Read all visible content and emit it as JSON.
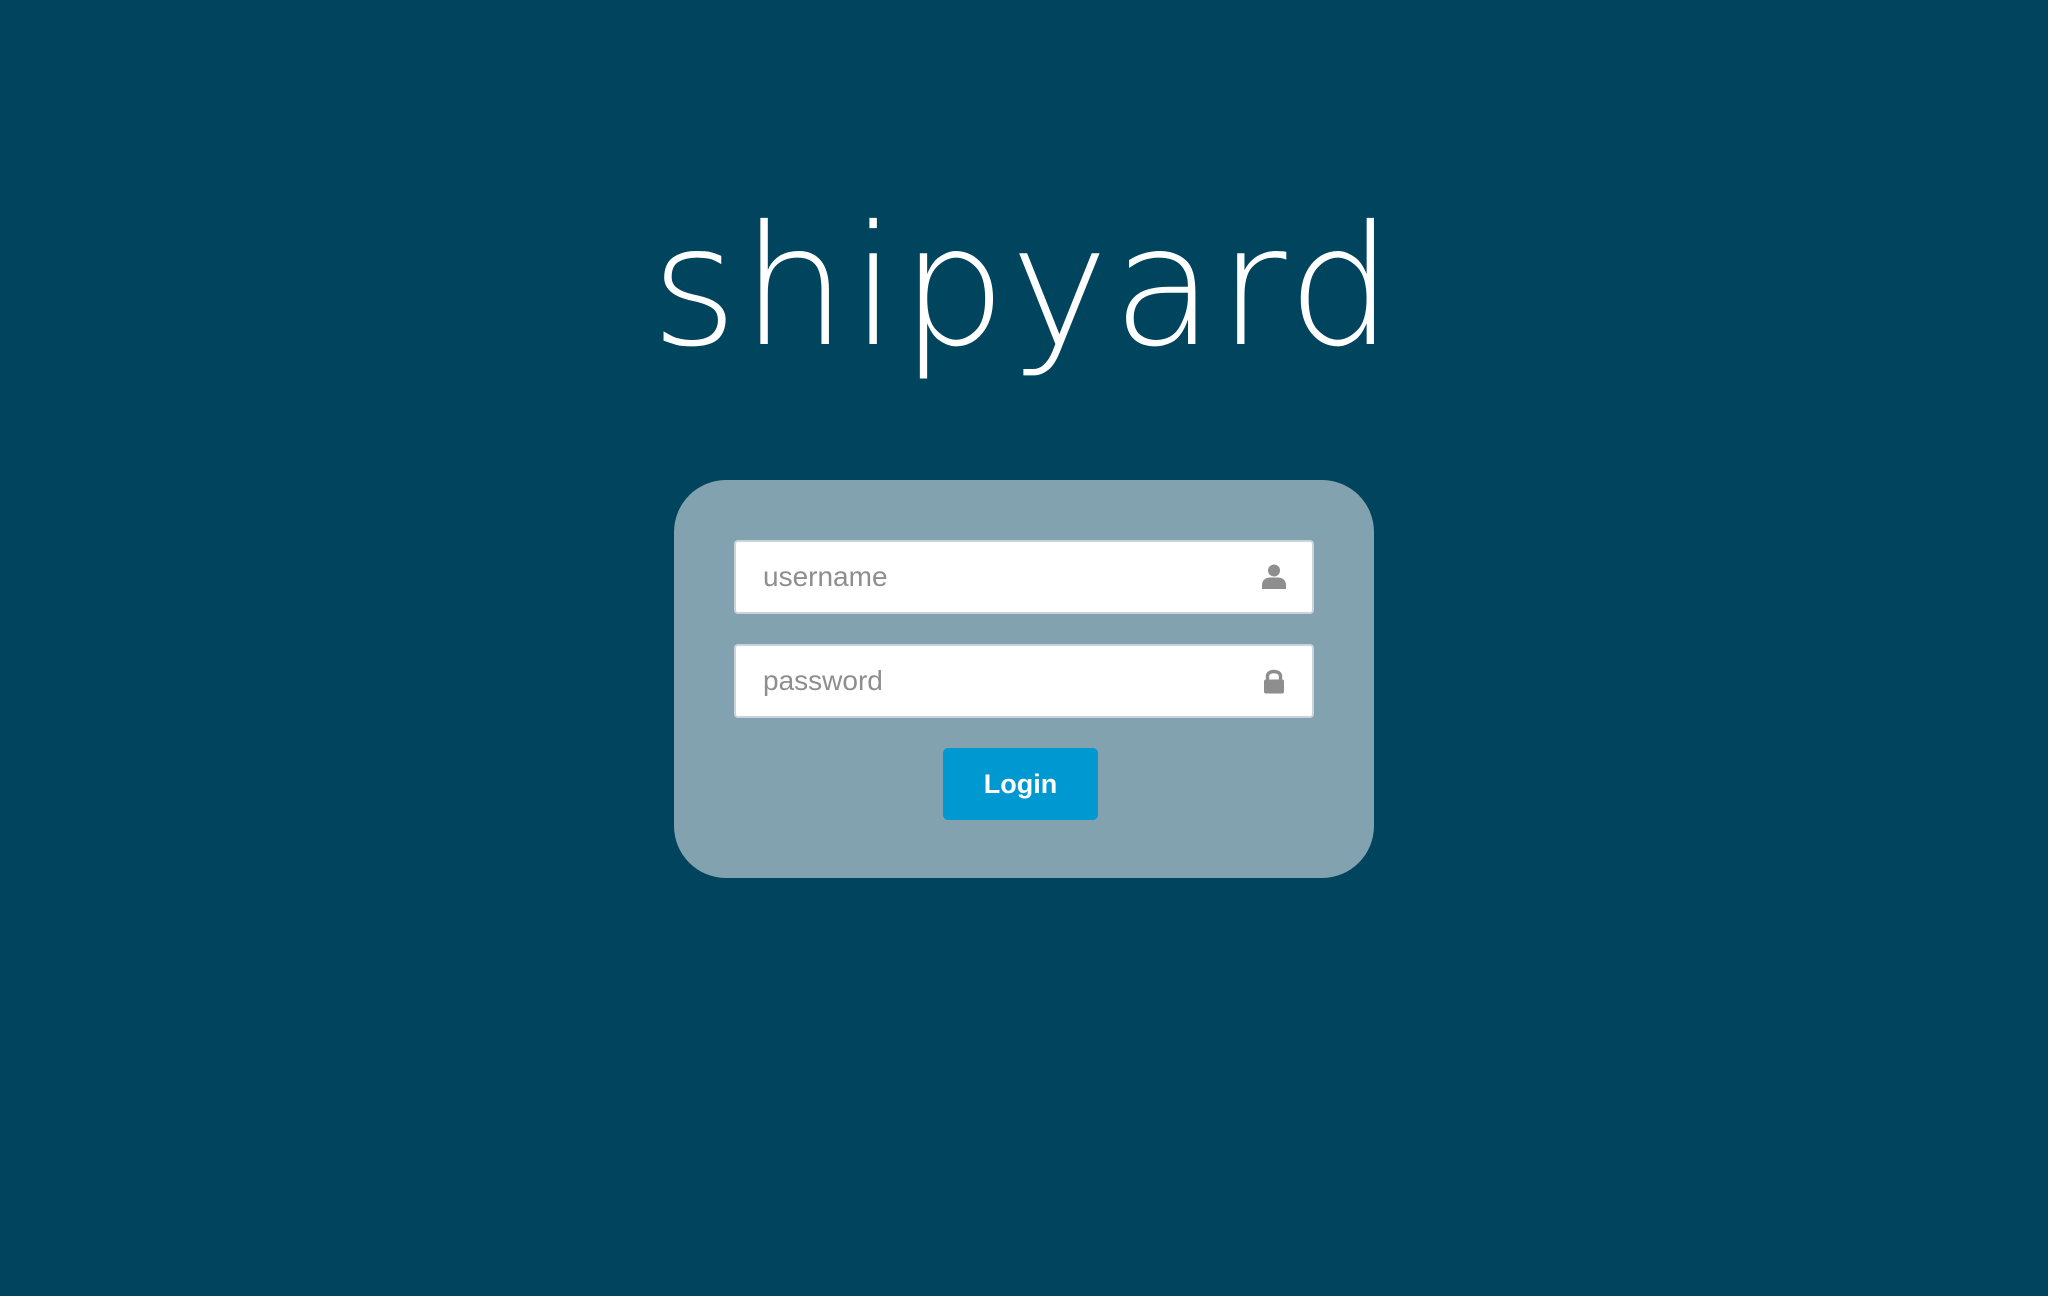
{
  "app": {
    "logo_text": "shipyard"
  },
  "login_form": {
    "username": {
      "value": "",
      "placeholder": "username",
      "icon": "user-icon"
    },
    "password": {
      "value": "",
      "placeholder": "password",
      "icon": "lock-icon"
    },
    "submit_label": "Login"
  },
  "colors": {
    "background": "#00445e",
    "card": "#83a2af",
    "button": "#0098d1",
    "icon": "#8e8e8e"
  }
}
